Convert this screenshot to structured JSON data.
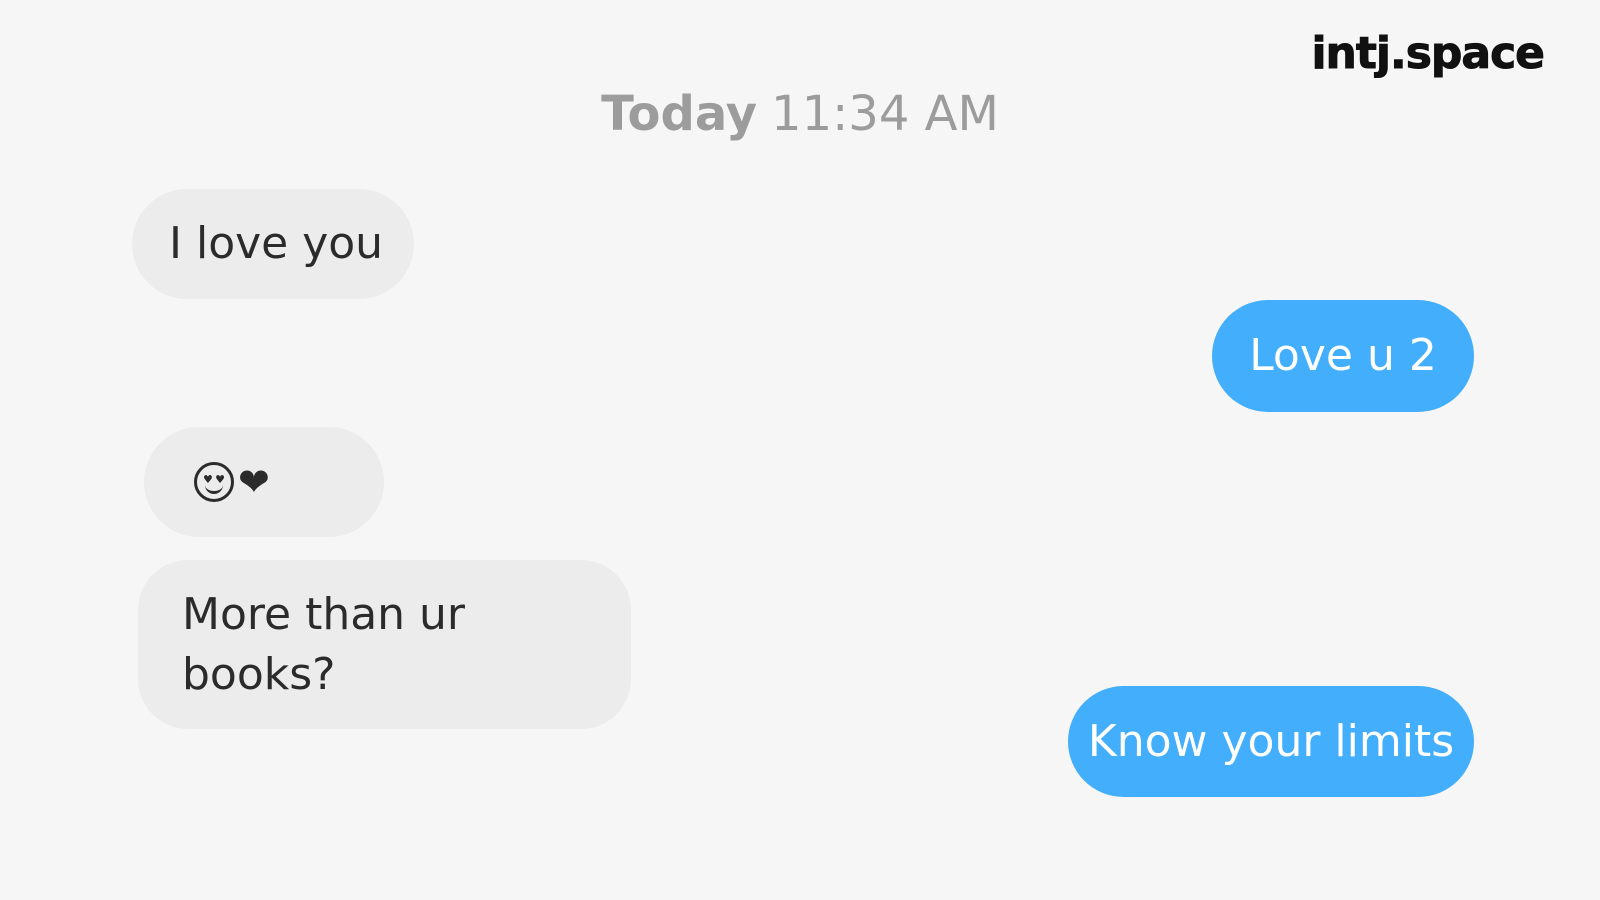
{
  "watermark": "intj.space",
  "header": {
    "day": "Today",
    "time": "11:34 AM"
  },
  "colors": {
    "background": "#f6f6f6",
    "received_bubble": "#ececec",
    "sent_bubble": "#43aefc",
    "timestamp_text": "#9c9c9c"
  },
  "messages": [
    {
      "direction": "received",
      "text": "I love you"
    },
    {
      "direction": "sent",
      "text": "Love u 2"
    },
    {
      "direction": "received",
      "text": "😍❤",
      "icons": [
        "heart-eyes-face-icon",
        "heart-icon"
      ]
    },
    {
      "direction": "received",
      "text": "More than ur books?"
    },
    {
      "direction": "sent",
      "text": "Know your limits"
    }
  ]
}
